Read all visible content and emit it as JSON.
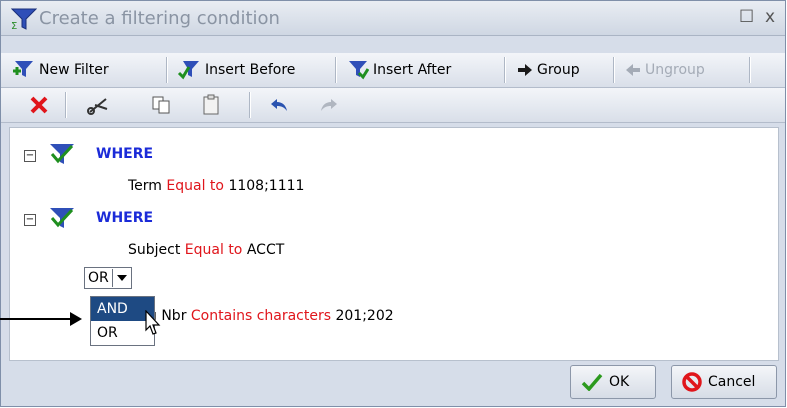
{
  "window": {
    "title": "Create a filtering condition",
    "maximize_glyph": "☐",
    "close_glyph": "x"
  },
  "toolbar1": {
    "new_filter": "New Filter",
    "insert_before": "Insert Before",
    "insert_after": "Insert After",
    "group": "Group",
    "ungroup": "Ungroup"
  },
  "toolbar2": {
    "delete_icon": "delete-icon",
    "cut_icon": "cut-icon",
    "copy_icon": "copy-icon",
    "paste_icon": "paste-icon",
    "undo_icon": "undo-icon",
    "redo_icon": "redo-icon"
  },
  "tree": {
    "where1": {
      "label": "WHERE",
      "field": "Term",
      "operator": "Equal to",
      "value": "1108;1111"
    },
    "where2": {
      "label": "WHERE",
      "field": "Subject",
      "operator": "Equal to",
      "value": "ACCT"
    },
    "connector": {
      "selected": "OR",
      "options": [
        "AND",
        "OR"
      ],
      "highlighted": "AND"
    },
    "cond3": {
      "field_visible": "g Nbr",
      "operator": "Contains characters",
      "value": "201;202"
    }
  },
  "footer": {
    "ok": "OK",
    "cancel": "Cancel"
  },
  "colors": {
    "where": "#1b2bd8",
    "operator": "#e0151b",
    "selected_option": "#1e4a83"
  }
}
